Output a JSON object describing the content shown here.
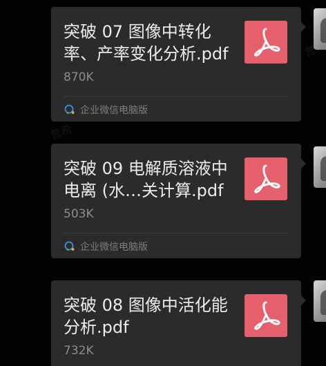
{
  "messages": [
    {
      "file_name": "突破 07 图像中转化率、产率变化分析.pdf",
      "file_size": "870K",
      "source": "企业微信电脑版",
      "file_type_icon": "pdf-icon"
    },
    {
      "file_name": "突破 09 电解质溶液中电离 (水…关计算.pdf",
      "file_size": "503K",
      "source": "企业微信电脑版",
      "file_type_icon": "pdf-icon"
    },
    {
      "file_name": "突破 08 图像中活化能分析.pdf",
      "file_size": "732K",
      "source": "",
      "file_type_icon": "pdf-icon"
    }
  ],
  "watermark_text": "曾希",
  "colors": {
    "background": "#020202",
    "bubble": "#2b2b2b",
    "pdf_icon_bg": "#e5606c",
    "title_text": "#ececec",
    "meta_text": "#8c8c8c"
  }
}
